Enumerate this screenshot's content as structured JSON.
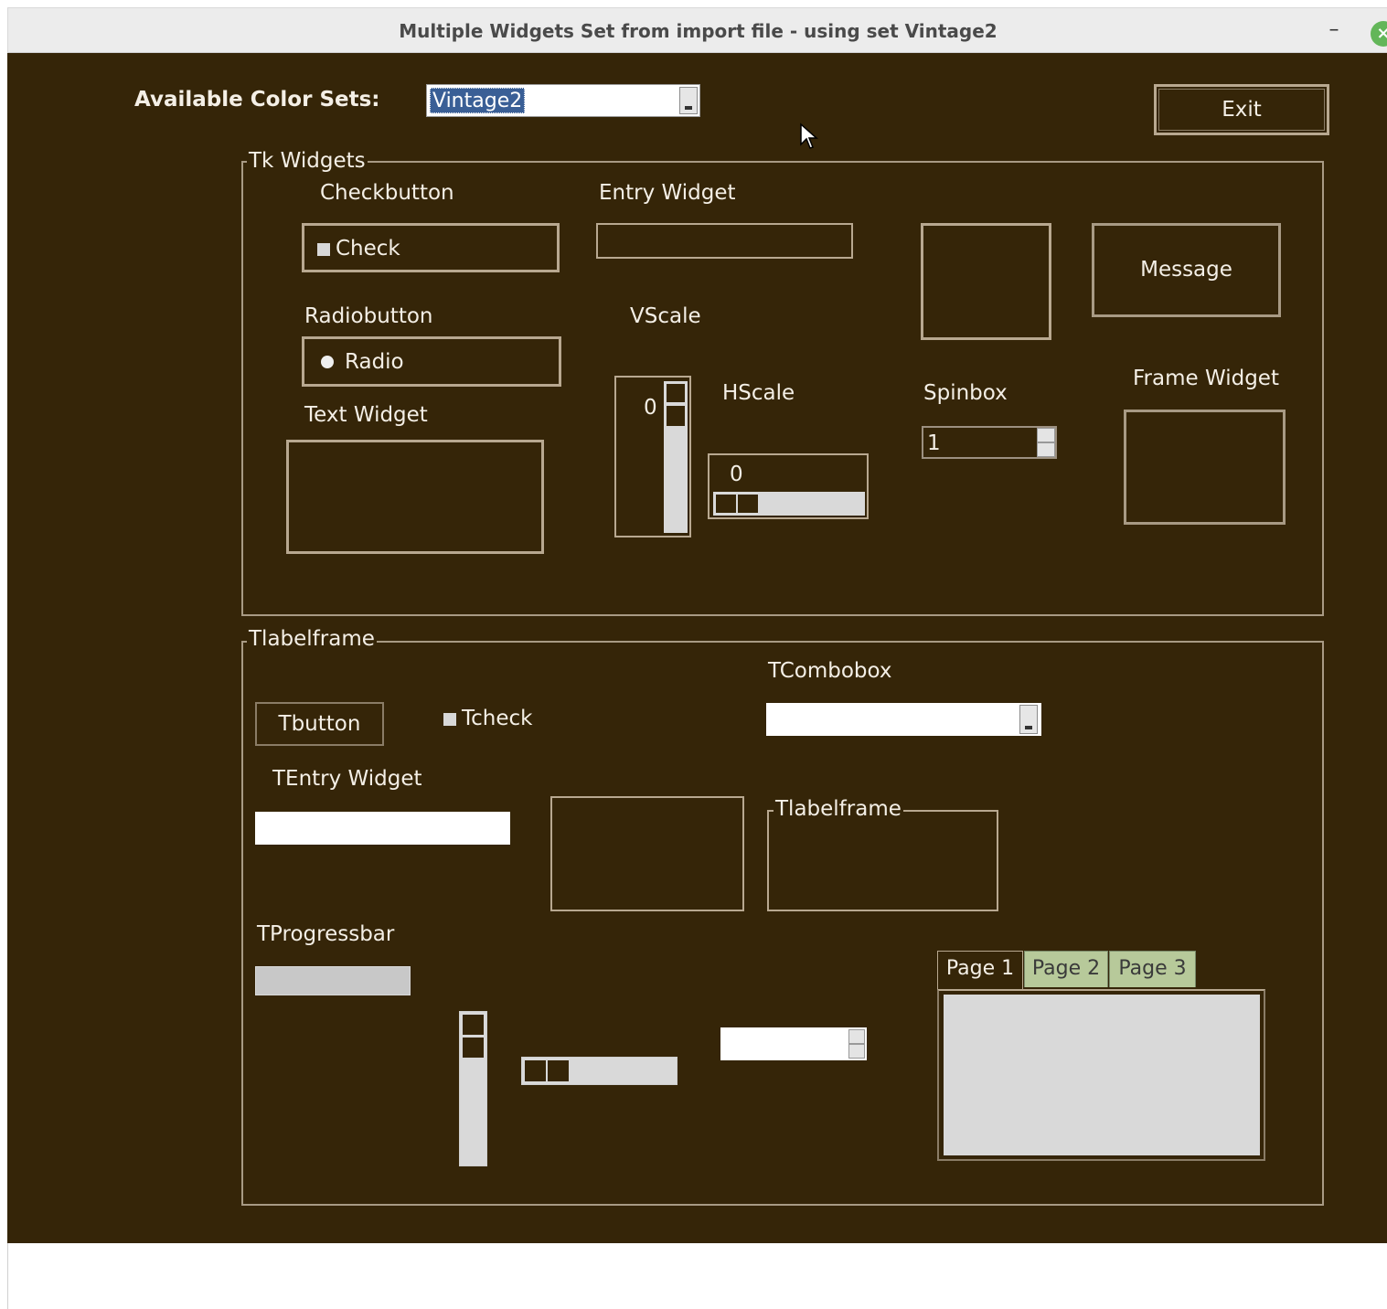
{
  "window": {
    "title": "Multiple Widgets Set from import file - using set Vintage2",
    "minimize_glyph": "–",
    "close_glyph": "×"
  },
  "top": {
    "color_sets_label": "Available Color Sets:",
    "color_set_value": "Vintage2",
    "exit_label": "Exit"
  },
  "tk": {
    "legend": "Tk Widgets",
    "checkbutton_label": "Checkbutton",
    "check_text": "Check",
    "entry_label": "Entry Widget",
    "entry_value": "",
    "message_text": "Message",
    "radiobutton_label": "Radiobutton",
    "radio_text": "Radio",
    "vscale_label": "VScale",
    "vscale_value": "0",
    "hscale_label": "HScale",
    "hscale_value": "0",
    "spinbox_label": "Spinbox",
    "spinbox_value": "1",
    "frame_label": "Frame Widget",
    "text_label": "Text Widget"
  },
  "ttk": {
    "legend": "Tlabelframe",
    "button_text": "Tbutton",
    "check_text": "Tcheck",
    "combobox_label": "TCombobox",
    "combobox_value": "",
    "entry_label": "TEntry Widget",
    "entry_value": "",
    "inner_legend": "Tlabelframe",
    "progress_label": "TProgressbar",
    "tspin_value": "",
    "tabs": [
      "Page 1",
      "Page 2",
      "Page 3"
    ]
  },
  "colors": {
    "background": "#352508",
    "foreground": "#f4efe6",
    "tab_inactive": "#b7c99a",
    "selection": "#3a5f96"
  }
}
